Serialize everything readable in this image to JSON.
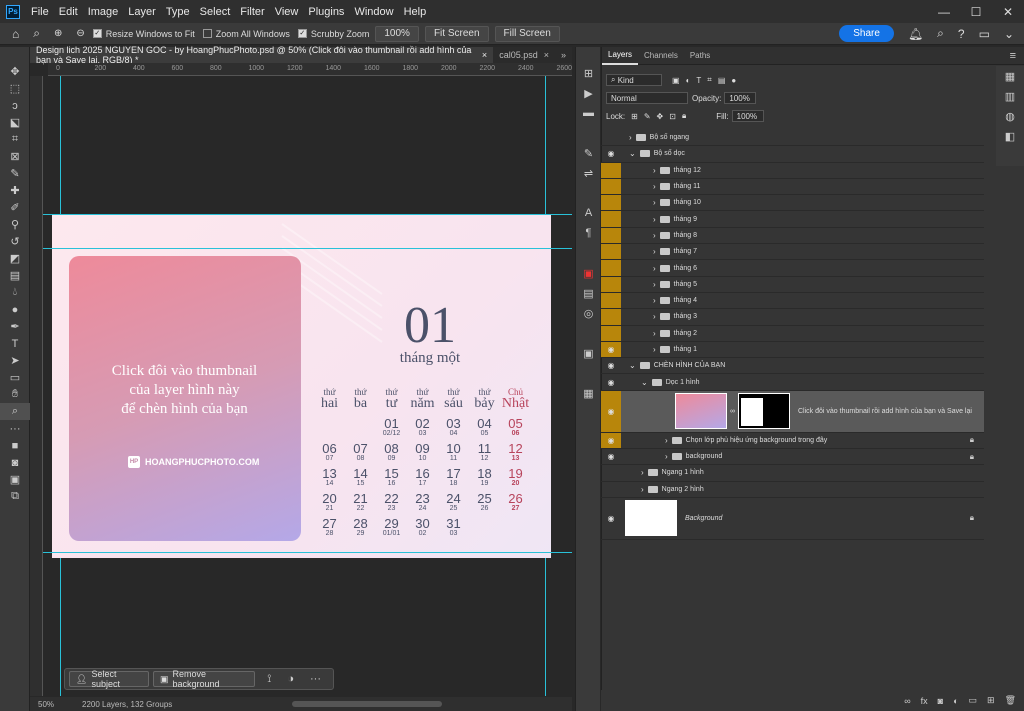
{
  "menubar": {
    "logo": "Ps",
    "items": [
      "File",
      "Edit",
      "Image",
      "Layer",
      "Type",
      "Select",
      "Filter",
      "View",
      "Plugins",
      "Window",
      "Help"
    ],
    "window_controls": [
      "—",
      "☐",
      "✕"
    ]
  },
  "options": {
    "resize_windows": "Resize Windows to Fit",
    "zoom_all": "Zoom All Windows",
    "scrubby": "Scrubby Zoom",
    "zoom_pct": "100%",
    "fit_screen": "Fit Screen",
    "fill_screen": "Fill Screen",
    "share": "Share"
  },
  "tabs": {
    "active": "Design lich 2025 NGUYEN GOC - by HoangPhucPhoto.psd @ 50% (Click đôi vào thumbnail rồi add hình của bạn và Save lại, RGB/8) *",
    "second": "cal05.psd",
    "close": "×",
    "more": "»"
  },
  "ruler": {
    "ticks": [
      "0",
      "200",
      "400",
      "600",
      "800",
      "1000",
      "1200",
      "1400",
      "1600",
      "1800",
      "2000",
      "2200",
      "2400",
      "2600"
    ]
  },
  "canvas": {
    "photo_text": [
      "Click đôi vào thumbnail",
      "của layer hình này",
      "để chèn hình của bạn"
    ],
    "brand_logo": "HP",
    "brand": "HOANGPHUCPHOTO.COM",
    "month_num": "01",
    "month_name": "tháng một",
    "weekdays": [
      [
        "thứ",
        "hai"
      ],
      [
        "thứ",
        "ba"
      ],
      [
        "thứ",
        "tư"
      ],
      [
        "thứ",
        "năm"
      ],
      [
        "thứ",
        "sáu"
      ],
      [
        "thứ",
        "bảy"
      ],
      [
        "Chủ",
        "Nhật"
      ]
    ],
    "weeks": [
      [
        [
          "",
          ""
        ],
        [
          "",
          ""
        ],
        [
          "01",
          "02/12"
        ],
        [
          "02",
          "03"
        ],
        [
          "03",
          "04"
        ],
        [
          "04",
          "05"
        ],
        [
          "05",
          "06"
        ]
      ],
      [
        [
          "06",
          "07"
        ],
        [
          "07",
          "08"
        ],
        [
          "08",
          "09"
        ],
        [
          "09",
          "10"
        ],
        [
          "10",
          "11"
        ],
        [
          "11",
          "12"
        ],
        [
          "12",
          "13"
        ]
      ],
      [
        [
          "13",
          "14"
        ],
        [
          "14",
          "15"
        ],
        [
          "15",
          "16"
        ],
        [
          "16",
          "17"
        ],
        [
          "17",
          "18"
        ],
        [
          "18",
          "19"
        ],
        [
          "19",
          "20"
        ]
      ],
      [
        [
          "20",
          "21"
        ],
        [
          "21",
          "22"
        ],
        [
          "22",
          "23"
        ],
        [
          "23",
          "24"
        ],
        [
          "24",
          "25"
        ],
        [
          "25",
          "26"
        ],
        [
          "26",
          "27"
        ]
      ],
      [
        [
          "27",
          "28"
        ],
        [
          "28",
          "29"
        ],
        [
          "29",
          "01/01"
        ],
        [
          "30",
          "02"
        ],
        [
          "31",
          "03"
        ],
        [
          "",
          ""
        ],
        [
          "",
          ""
        ]
      ]
    ]
  },
  "context": {
    "select_subject": "Select subject",
    "remove_bg": "Remove background",
    "more": "···"
  },
  "status": {
    "zoom": "50%",
    "info": "2200 Layers, 132 Groups"
  },
  "panel": {
    "tabs": [
      "Layers",
      "Channels",
      "Paths"
    ],
    "kind": "Kind",
    "blend": "Normal",
    "opacity_label": "Opacity:",
    "opacity": "100%",
    "lock_label": "Lock:",
    "fill_label": "Fill:",
    "fill": "100%",
    "layers": [
      {
        "name": "Bộ số ngang",
        "type": "group",
        "visible": false,
        "gold": false,
        "indent": 0
      },
      {
        "name": "Bộ số dọc",
        "type": "group",
        "visible": true,
        "gold": false,
        "indent": 0,
        "open": true
      },
      {
        "name": "tháng 12",
        "type": "group",
        "visible": false,
        "gold": true,
        "indent": 2
      },
      {
        "name": "tháng 11",
        "type": "group",
        "visible": false,
        "gold": true,
        "indent": 2
      },
      {
        "name": "tháng 10",
        "type": "group",
        "visible": false,
        "gold": true,
        "indent": 2
      },
      {
        "name": "tháng 9",
        "type": "group",
        "visible": false,
        "gold": true,
        "indent": 2
      },
      {
        "name": "tháng 8",
        "type": "group",
        "visible": false,
        "gold": true,
        "indent": 2
      },
      {
        "name": "tháng 7",
        "type": "group",
        "visible": false,
        "gold": true,
        "indent": 2
      },
      {
        "name": "tháng 6",
        "type": "group",
        "visible": false,
        "gold": true,
        "indent": 2
      },
      {
        "name": "tháng 5",
        "type": "group",
        "visible": false,
        "gold": true,
        "indent": 2
      },
      {
        "name": "tháng 4",
        "type": "group",
        "visible": false,
        "gold": true,
        "indent": 2
      },
      {
        "name": "tháng 3",
        "type": "group",
        "visible": false,
        "gold": true,
        "indent": 2
      },
      {
        "name": "tháng 2",
        "type": "group",
        "visible": false,
        "gold": true,
        "indent": 2
      },
      {
        "name": "tháng 1",
        "type": "group",
        "visible": true,
        "gold": true,
        "indent": 2
      },
      {
        "name": "CHÈN HÌNH CỦA BẠN",
        "type": "group",
        "visible": true,
        "gold": false,
        "indent": 0,
        "open": true
      },
      {
        "name": "Dọc 1 hình",
        "type": "group",
        "visible": true,
        "gold": false,
        "indent": 1,
        "open": true
      }
    ],
    "selected_layer": "Click đôi vào thumbnail rồi add hình của bạn và Save lại",
    "layers2": [
      {
        "name": "Chọn lớp phủ hiệu ứng background trong đây",
        "visible": true,
        "gold": true,
        "indent": 3,
        "lock": true
      },
      {
        "name": "background",
        "visible": true,
        "gold": false,
        "indent": 3,
        "lock": true
      },
      {
        "name": "Ngang 1 hình",
        "visible": false,
        "gold": false,
        "indent": 1
      },
      {
        "name": "Ngang 2 hình",
        "visible": false,
        "gold": false,
        "indent": 1
      }
    ],
    "background_layer": "Background"
  },
  "colors": {
    "accent": "#1473e6",
    "gold": "#b8860b",
    "guide": "#29c1d8",
    "calendar_text": "#4b5169",
    "sunday": "#b8445c"
  }
}
